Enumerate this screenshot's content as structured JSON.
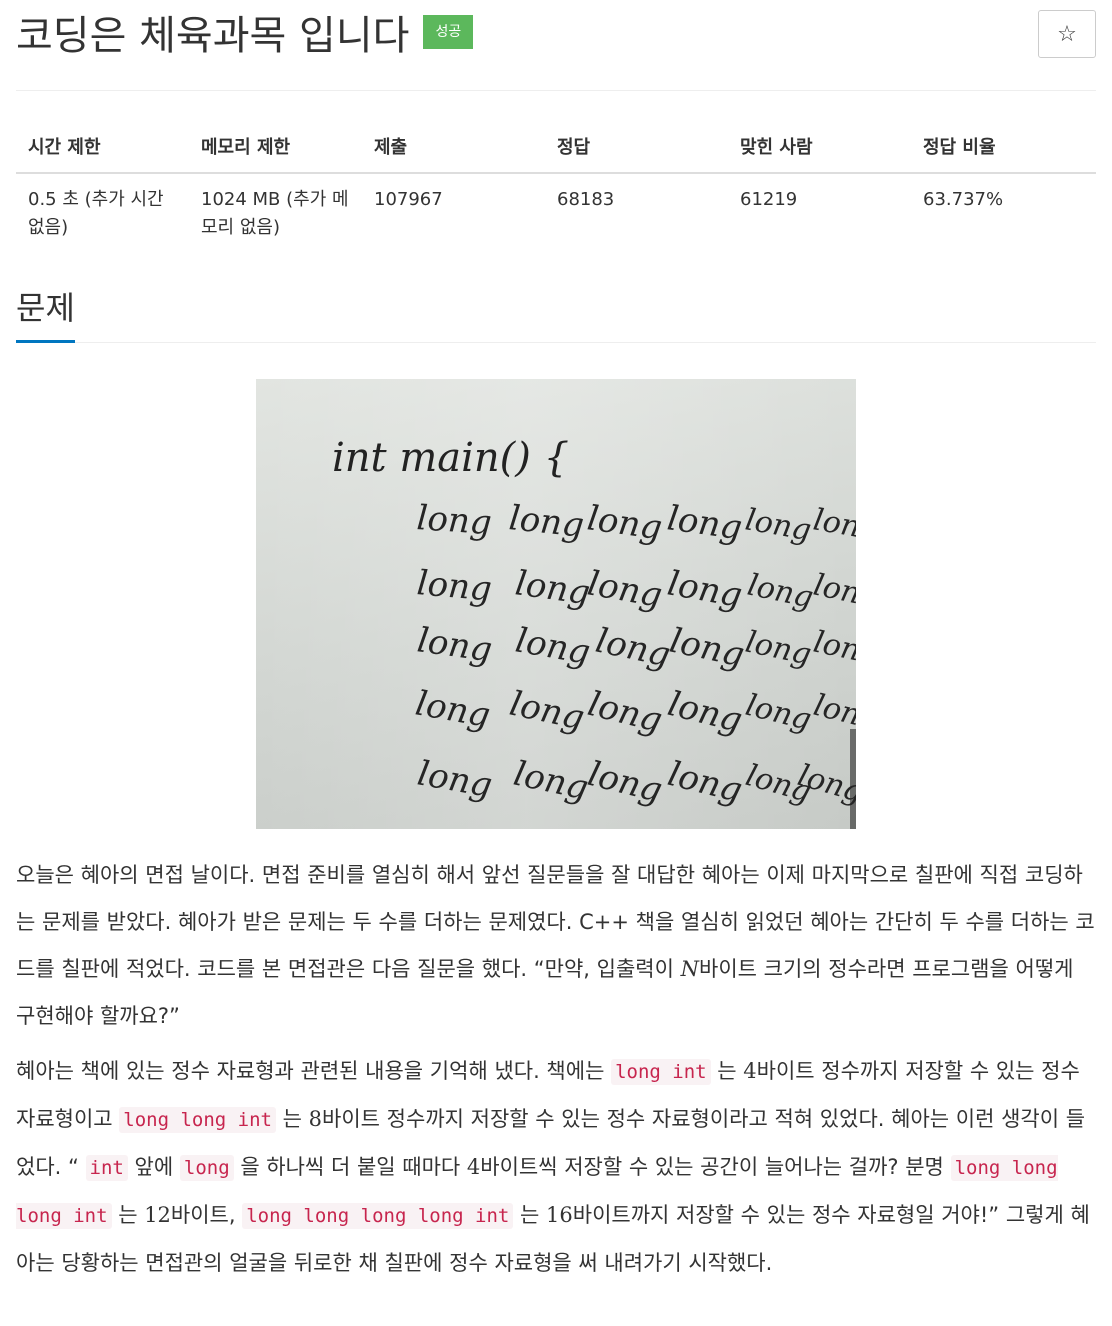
{
  "header": {
    "title": "코딩은 체육과목 입니다",
    "badge": "성공",
    "star": "☆"
  },
  "info_table": {
    "headers": [
      "시간 제한",
      "메모리 제한",
      "제출",
      "정답",
      "맞힌 사람",
      "정답 비율"
    ],
    "values": [
      "0.5 초 (추가 시간 없음)",
      "1024 MB (추가 메모리 없음)",
      "107967",
      "68183",
      "61219",
      "63.737%"
    ]
  },
  "section": {
    "title": "문제"
  },
  "image": {
    "alt": "칠판에 쓰인 코드",
    "line1": "int main() {",
    "word": "long"
  },
  "problem": {
    "p1": {
      "text1": "오늘은 혜아의 면접 날이다. 면접 준비를 열심히 해서 앞선 질문들을 잘 대답한 혜아는 이제 마지막으로 칠판에 직접 코딩하는 문제를 받았다. 혜아가 받은 문제는 두 수를 더하는 문제였다. C++ 책을 열심히 읽었던 혜아는 간단히 두 수를 더하는 코드를 칠판에 적었다. 코드를 본 면접관은 다음 질문을 했다. “만약, 입출력이 ",
      "n": "N",
      "text2": "바이트 크기의 정수라면 프로그램을 어떻게 구현해야 할까요?”"
    },
    "p2": {
      "s1": "혜아는 책에 있는 정수 자료형과 관련된 내용을 기억해 냈다. 책에는 ",
      "c1": "long int",
      "s2": " 는 ",
      "n1": "4",
      "s3": "바이트 정수까지 저장할 수 있는 정수 자료형이고 ",
      "c2": "long long int",
      "s4": " 는 ",
      "n2": "8",
      "s5": "바이트 정수까지 저장할 수 있는 정수 자료형이라고 적혀 있었다. 혜아는 이런 생각이 들었다. “ ",
      "c3": "int",
      "s6": " 앞에 ",
      "c4": "long",
      "s7": " 을 하나씩 더 붙일 때마다 ",
      "n3": "4",
      "s8": "바이트씩 저장할 수 있는 공간이 늘어나는 걸까? 분명 ",
      "c5": "long long long int",
      "s9": " 는 ",
      "n4": "12",
      "s10": "바이트, ",
      "c6": "long long long long int",
      "s11": " 는 ",
      "n5": "16",
      "s12": "바이트까지 저장할 수 있는 정수 자료형일 거야!” 그렇게 혜아는 당황하는 면접관의 얼굴을 뒤로한 채 칠판에 정수 자료형을 써 내려가기 시작했다."
    }
  },
  "colors": {
    "badge": "#5cb85c",
    "accent": "#0076c0",
    "code": "#c7254e"
  }
}
